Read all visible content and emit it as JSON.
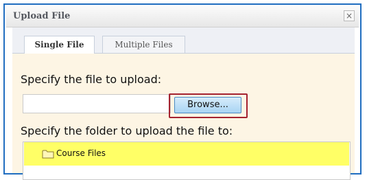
{
  "dialog": {
    "title": "Upload File",
    "close_symbol": "×",
    "tabs": [
      {
        "label": "Single File",
        "active": true
      },
      {
        "label": "Multiple Files",
        "active": false
      }
    ],
    "file_prompt": "Specify the file to upload:",
    "file_value": "",
    "browse_label": "Browse...",
    "folder_prompt": "Specify the folder to upload the file to:",
    "folders": [
      {
        "label": "Course Files",
        "icon": "folder-icon",
        "selected": true
      }
    ]
  },
  "colors": {
    "frame_border": "#1f6dc0",
    "panel_bg": "#fdf5e4",
    "selected_row": "#ffff66",
    "highlight_box": "#a4222f",
    "browse_button": "#a9d4f3"
  }
}
